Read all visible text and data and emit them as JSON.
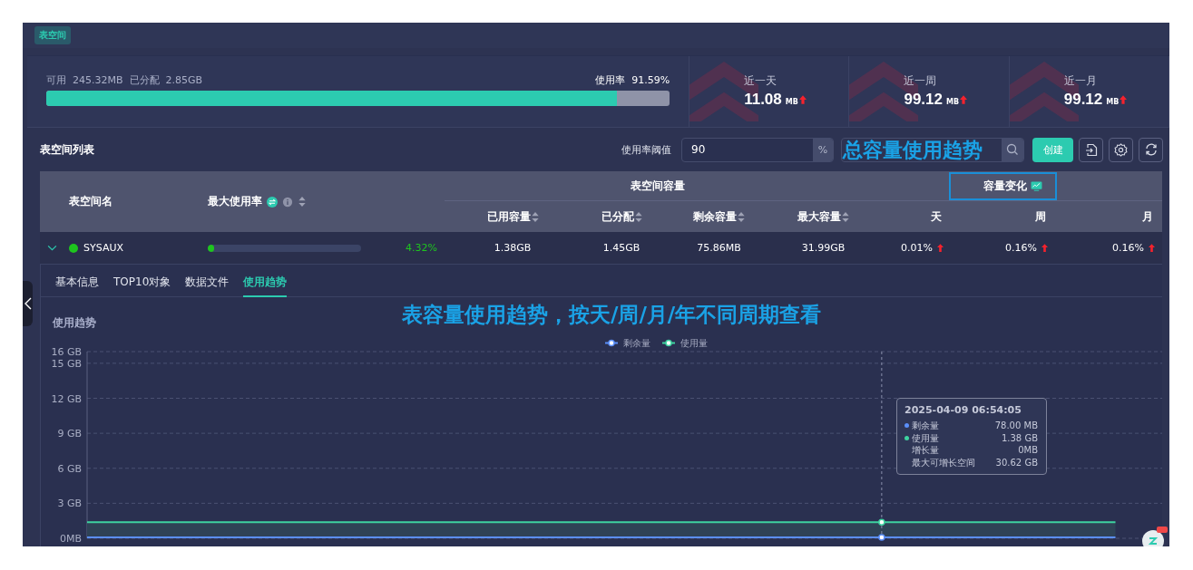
{
  "header": {
    "tag": "表空间"
  },
  "summary": {
    "available_label": "可用",
    "available": "245.32MB",
    "allocated_label": "已分配",
    "allocated": "2.85GB",
    "usage_label": "使用率",
    "usage": "91.59%",
    "level": 0.9159
  },
  "stats": [
    {
      "label": "近一天",
      "value": "11.08",
      "unit": "MB",
      "rising": true
    },
    {
      "label": "近一周",
      "value": "99.12",
      "unit": "MB",
      "rising": true
    },
    {
      "label": "近一月",
      "value": "99.12",
      "unit": "MB",
      "rising": true
    }
  ],
  "list": {
    "title": "表空间列表",
    "threshold_label": "使用率阈值",
    "threshold": "90",
    "threshold_unit": "%",
    "create_button": "创建"
  },
  "table": {
    "group_headers": [
      "表空间容量",
      "容量变化"
    ],
    "columns": [
      {
        "label": "表空间名",
        "sortable": false
      },
      {
        "label": "最大使用率",
        "sortable": true
      },
      {
        "label": "已用容量",
        "sortable": true
      },
      {
        "label": "已分配",
        "sortable": true
      },
      {
        "label": "剩余容量",
        "sortable": true
      },
      {
        "label": "最大容量",
        "sortable": true
      },
      {
        "label": "天",
        "sortable": false
      },
      {
        "label": "周",
        "sortable": false
      },
      {
        "label": "月",
        "sortable": false
      }
    ],
    "rows": [
      {
        "expanded": true,
        "color": "#1ec51e",
        "name": "SYSAUX",
        "level": 0.0432,
        "usage": "4.32%",
        "used": "1.38GB",
        "allocated": "1.45GB",
        "free": "75.86MB",
        "max": "31.99GB",
        "changes": [
          {
            "value": "0.01%",
            "rising": true
          },
          {
            "value": "0.16%",
            "rising": true
          },
          {
            "value": "0.16%",
            "rising": true
          }
        ]
      }
    ]
  },
  "detail_tabs": [
    {
      "label": "基本信息",
      "selected": false
    },
    {
      "label": "TOP10对象",
      "selected": false
    },
    {
      "label": "数据文件",
      "selected": false
    },
    {
      "label": "使用趋势",
      "selected": true
    }
  ],
  "chart_data": {
    "type": "line",
    "title": "使用趋势",
    "ylim": [
      0,
      16
    ],
    "yticks": [
      {
        "value": 0,
        "label": "0MB"
      },
      {
        "value": 3,
        "label": "3 GB"
      },
      {
        "value": 6,
        "label": "6 GB"
      },
      {
        "value": 9,
        "label": "9 GB"
      },
      {
        "value": 12,
        "label": "12 GB"
      },
      {
        "value": 15,
        "label": "15 GB"
      },
      {
        "value": 16,
        "label": "16 GB"
      }
    ],
    "grid": true,
    "legend": "top",
    "series": [
      {
        "name": "剩余量",
        "color": "#5b8ff9",
        "values": [
          0.08,
          0.08,
          0.08,
          0.08,
          0.08,
          0.08,
          0.08,
          0.08,
          0.08,
          0.08,
          0.08,
          0.08,
          0.08,
          0.08,
          0.08,
          0.08,
          0.08,
          0.08,
          0.08,
          0.08,
          0.08,
          0.08,
          0.08,
          null
        ]
      },
      {
        "name": "使用量",
        "color": "#3ed3a0",
        "values": [
          1.38,
          1.38,
          1.38,
          1.38,
          1.38,
          1.38,
          1.38,
          1.38,
          1.38,
          1.38,
          1.38,
          1.38,
          1.38,
          1.38,
          1.38,
          1.38,
          1.38,
          1.38,
          1.38,
          1.38,
          1.38,
          1.38,
          1.38,
          null
        ]
      }
    ]
  },
  "tooltip": {
    "title": "2025-04-09 06:54:05",
    "rows": [
      {
        "label": "剩余量",
        "value": "78.00 MB",
        "color": "#5b8ff9"
      },
      {
        "label": "使用量",
        "value": "1.38 GB",
        "color": "#3ed3a0"
      },
      {
        "label": "增长量",
        "value": "0MB"
      },
      {
        "label": "最大可增长空间",
        "value": "30.62 GB"
      }
    ]
  },
  "annotations": [
    {
      "text": "总容量使用趋势"
    },
    {
      "text": "表容量使用趋势，按天/周/月/年不同周期查看"
    }
  ]
}
